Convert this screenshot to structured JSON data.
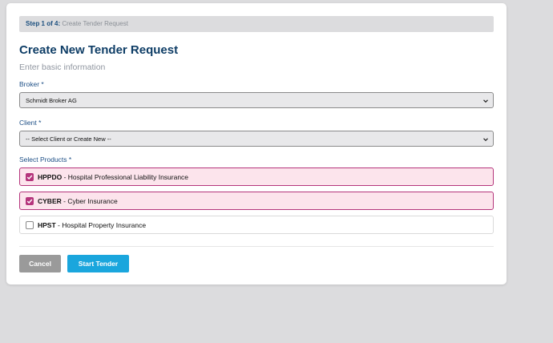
{
  "step": {
    "label": "Step 1 of 4:",
    "name": "Create Tender Request"
  },
  "header": {
    "title": "Create New Tender Request",
    "subtitle": "Enter basic information"
  },
  "broker": {
    "label": "Broker *",
    "selected": "Schmidt Broker AG"
  },
  "client": {
    "label": "Client *",
    "selected": "-- Select Client or Create New --"
  },
  "products": {
    "label": "Select Products *",
    "items": [
      {
        "code": "HPPDO",
        "name": " - Hospital Professional Liability Insurance",
        "checked": true
      },
      {
        "code": "CYBER",
        "name": " - Cyber Insurance",
        "checked": true
      },
      {
        "code": "HPST",
        "name": " - Hospital Property Insurance",
        "checked": false
      }
    ]
  },
  "actions": {
    "cancel": "Cancel",
    "start": "Start Tender"
  },
  "colors": {
    "accent": "#b5357c",
    "primary": "#1aa6dd",
    "heading": "#0e3d66"
  }
}
